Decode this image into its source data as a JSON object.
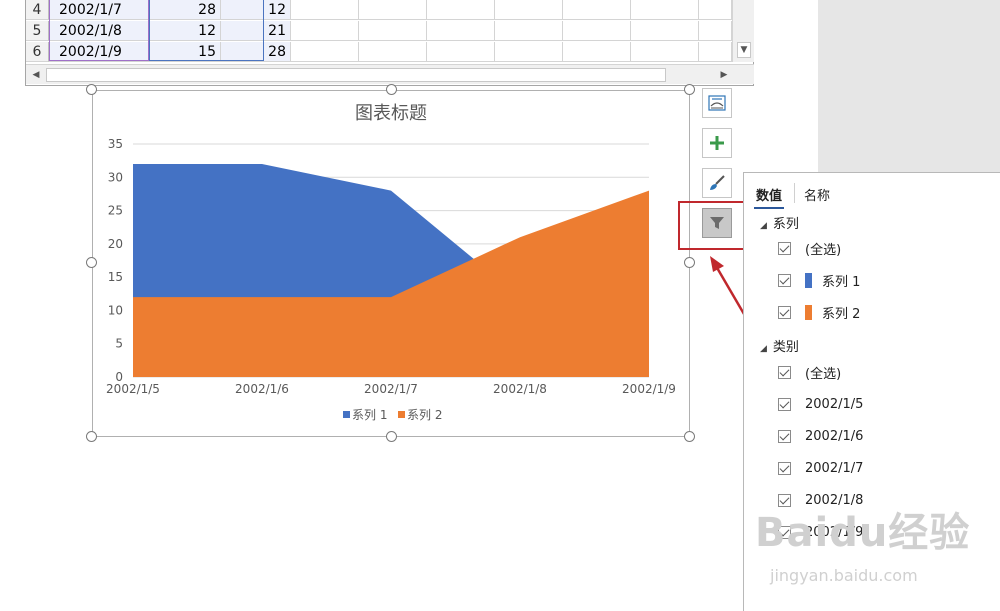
{
  "spreadsheet": {
    "rows": [
      {
        "num": "4",
        "date": "2002/1/7",
        "v1": "28",
        "v2": "12"
      },
      {
        "num": "5",
        "date": "2002/1/8",
        "v1": "12",
        "v2": "21"
      },
      {
        "num": "6",
        "date": "2002/1/9",
        "v1": "15",
        "v2": "28"
      }
    ]
  },
  "chart_data": {
    "type": "area",
    "title": "图表标题",
    "categories": [
      "2002/1/5",
      "2002/1/6",
      "2002/1/7",
      "2002/1/8",
      "2002/1/9"
    ],
    "series": [
      {
        "name": "系列 1",
        "color": "#4472c4",
        "values": [
          32,
          32,
          28,
          12,
          15
        ]
      },
      {
        "name": "系列 2",
        "color": "#ed7d31",
        "values": [
          12,
          12,
          12,
          21,
          28
        ]
      }
    ],
    "yticks": [
      0,
      5,
      10,
      15,
      20,
      25,
      30,
      35
    ],
    "ylim": [
      0,
      35
    ],
    "grid": true,
    "legend": "bottom",
    "stacking": "none"
  },
  "colors": {
    "series1": "#4472c4",
    "series2": "#ed7d31",
    "highlight": "#c0282d"
  },
  "tools": {
    "icons": [
      "chart-elements-icon",
      "plus-icon",
      "brush-icon",
      "filter-icon"
    ]
  },
  "filter_panel": {
    "tabs": [
      "数值",
      "名称"
    ],
    "series_head": "系列",
    "series_items": [
      "(全选)",
      "系列 1",
      "系列 2"
    ],
    "category_head": "类别",
    "category_items": [
      "(全选)",
      "2002/1/5",
      "2002/1/6",
      "2002/1/7",
      "2002/1/8",
      "2002/1/9"
    ]
  },
  "watermark": {
    "main": "Baidu经验",
    "sub": "jingyan.baidu.com"
  }
}
